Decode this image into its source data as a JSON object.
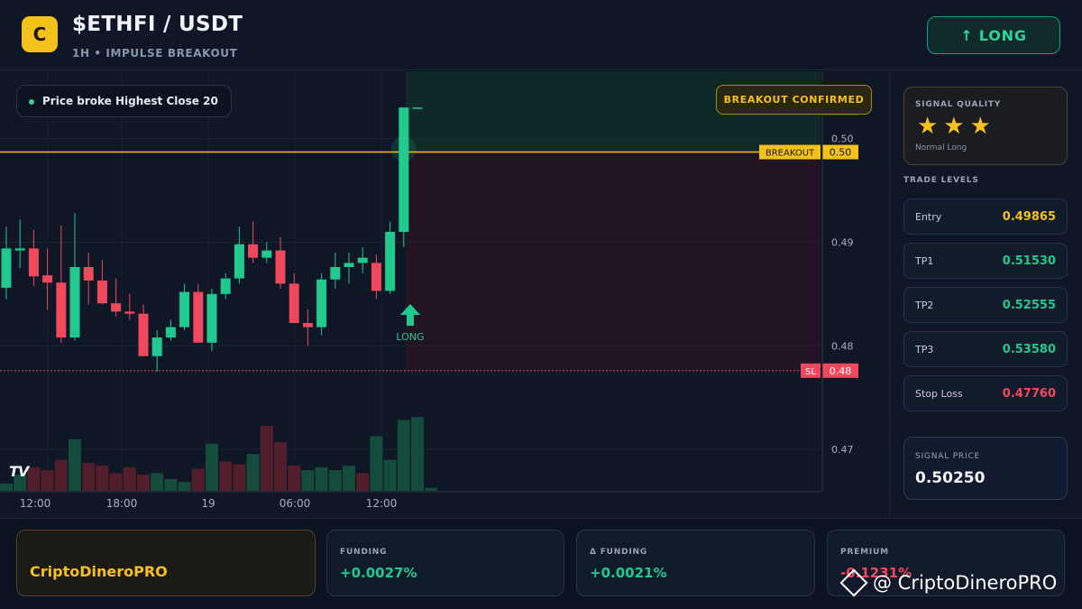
{
  "header": {
    "logo_letter": "C",
    "pair": "$ETHFI / USDT",
    "subtitle": "1H • IMPULSE BREAKOUT",
    "long_button": "↑ LONG"
  },
  "chart": {
    "price_pill": "Price broke Highest Close 20",
    "confirm_pill": "BREAKOUT CONFIRMED",
    "tv_logo": "TV",
    "long_marker_label": "LONG",
    "breakout_label": "BREAKOUT",
    "breakout_price": "0.50",
    "sl_label": "SL",
    "sl_price": "0.48",
    "current_price": "0.50",
    "y_ticks": [
      "0.50",
      "0.49",
      "0.48",
      "0.47"
    ],
    "x_ticks": [
      "12:00",
      "18:00",
      "19",
      "06:00",
      "12:00"
    ],
    "colors": {
      "up": "#22c98f",
      "down": "#f0485d",
      "breakout": "#f4c21a",
      "sl": "#f0485d"
    }
  },
  "chart_data": {
    "type": "candlestick",
    "breakout_level": 0.4987,
    "stop_loss_level": 0.4776,
    "ylim": [
      0.466,
      0.5065
    ],
    "candles": [
      {
        "o": 0.4856,
        "h": 0.4915,
        "l": 0.4845,
        "c": 0.4894
      },
      {
        "o": 0.4892,
        "h": 0.4922,
        "l": 0.4875,
        "c": 0.4894
      },
      {
        "o": 0.4894,
        "h": 0.4912,
        "l": 0.4858,
        "c": 0.4867
      },
      {
        "o": 0.4868,
        "h": 0.4894,
        "l": 0.4835,
        "c": 0.4861
      },
      {
        "o": 0.4861,
        "h": 0.4916,
        "l": 0.4803,
        "c": 0.4808
      },
      {
        "o": 0.4808,
        "h": 0.4928,
        "l": 0.4805,
        "c": 0.4876
      },
      {
        "o": 0.4876,
        "h": 0.489,
        "l": 0.484,
        "c": 0.4863
      },
      {
        "o": 0.4863,
        "h": 0.4883,
        "l": 0.484,
        "c": 0.4841
      },
      {
        "o": 0.4841,
        "h": 0.4865,
        "l": 0.4828,
        "c": 0.4833
      },
      {
        "o": 0.4833,
        "h": 0.485,
        "l": 0.4825,
        "c": 0.4831
      },
      {
        "o": 0.4831,
        "h": 0.484,
        "l": 0.479,
        "c": 0.479
      },
      {
        "o": 0.479,
        "h": 0.4815,
        "l": 0.4775,
        "c": 0.4808
      },
      {
        "o": 0.4808,
        "h": 0.4825,
        "l": 0.4805,
        "c": 0.4818
      },
      {
        "o": 0.4818,
        "h": 0.486,
        "l": 0.4815,
        "c": 0.4852
      },
      {
        "o": 0.4852,
        "h": 0.486,
        "l": 0.4803,
        "c": 0.4803
      },
      {
        "o": 0.4803,
        "h": 0.4855,
        "l": 0.4795,
        "c": 0.485
      },
      {
        "o": 0.485,
        "h": 0.487,
        "l": 0.4845,
        "c": 0.4865
      },
      {
        "o": 0.4865,
        "h": 0.4915,
        "l": 0.486,
        "c": 0.4898
      },
      {
        "o": 0.4898,
        "h": 0.492,
        "l": 0.488,
        "c": 0.4885
      },
      {
        "o": 0.4885,
        "h": 0.49,
        "l": 0.488,
        "c": 0.4892
      },
      {
        "o": 0.4892,
        "h": 0.4905,
        "l": 0.4855,
        "c": 0.486
      },
      {
        "o": 0.486,
        "h": 0.487,
        "l": 0.483,
        "c": 0.4822
      },
      {
        "o": 0.4822,
        "h": 0.4835,
        "l": 0.48,
        "c": 0.4818
      },
      {
        "o": 0.4818,
        "h": 0.487,
        "l": 0.481,
        "c": 0.4864
      },
      {
        "o": 0.4864,
        "h": 0.489,
        "l": 0.4855,
        "c": 0.4876
      },
      {
        "o": 0.4876,
        "h": 0.489,
        "l": 0.486,
        "c": 0.488
      },
      {
        "o": 0.488,
        "h": 0.4895,
        "l": 0.487,
        "c": 0.4885
      },
      {
        "o": 0.488,
        "h": 0.4888,
        "l": 0.4845,
        "c": 0.4853
      },
      {
        "o": 0.4853,
        "h": 0.492,
        "l": 0.485,
        "c": 0.491
      },
      {
        "o": 0.491,
        "h": 0.5025,
        "l": 0.4895,
        "c": 0.503
      },
      {
        "o": 0.503,
        "h": 0.503,
        "l": 0.503,
        "c": 0.503
      }
    ],
    "volumes": [
      0.5,
      1.1,
      1.6,
      1.4,
      2.1,
      3.5,
      1.9,
      1.7,
      1.2,
      1.6,
      1.1,
      1.2,
      0.8,
      0.6,
      1.5,
      3.2,
      2.0,
      1.8,
      2.5,
      4.4,
      3.3,
      1.7,
      1.4,
      1.6,
      1.4,
      1.7,
      1.2,
      3.7,
      2.1,
      4.8,
      5.0,
      0.2
    ],
    "volume_direction": [
      "up",
      "up",
      "down",
      "down",
      "down",
      "up",
      "down",
      "down",
      "down",
      "down",
      "down",
      "up",
      "up",
      "up",
      "down",
      "up",
      "down",
      "down",
      "up",
      "down",
      "down",
      "down",
      "up",
      "up",
      "up",
      "up",
      "down",
      "up",
      "up",
      "up",
      "up",
      "up"
    ]
  },
  "panel": {
    "signal_quality_title": "SIGNAL QUALITY",
    "stars": "★★★",
    "signal_quality_sub": "Normal Long",
    "trade_levels_title": "TRADE LEVELS",
    "levels": [
      {
        "label": "Entry",
        "value": "0.49865",
        "color": "#f4c21a"
      },
      {
        "label": "TP1",
        "value": "0.51530",
        "color": "#22c98f"
      },
      {
        "label": "TP2",
        "value": "0.52555",
        "color": "#22c98f"
      },
      {
        "label": "TP3",
        "value": "0.53580",
        "color": "#22c98f"
      },
      {
        "label": "Stop Loss",
        "value": "0.47760",
        "color": "#f0485d"
      }
    ],
    "signal_price_title": "SIGNAL PRICE",
    "signal_price": "0.50250"
  },
  "footer": {
    "brand": "CriptoDineroPRO",
    "stats": [
      {
        "label": "FUNDING",
        "value": "+0.0027%",
        "color": "#22c98f"
      },
      {
        "label": "Δ FUNDING",
        "value": "+0.0021%",
        "color": "#22c98f"
      },
      {
        "label": "PREMIUM",
        "value": "-0.1231%",
        "color": "#f0485d"
      }
    ],
    "watermark": "@ CriptoDineroPRO"
  }
}
